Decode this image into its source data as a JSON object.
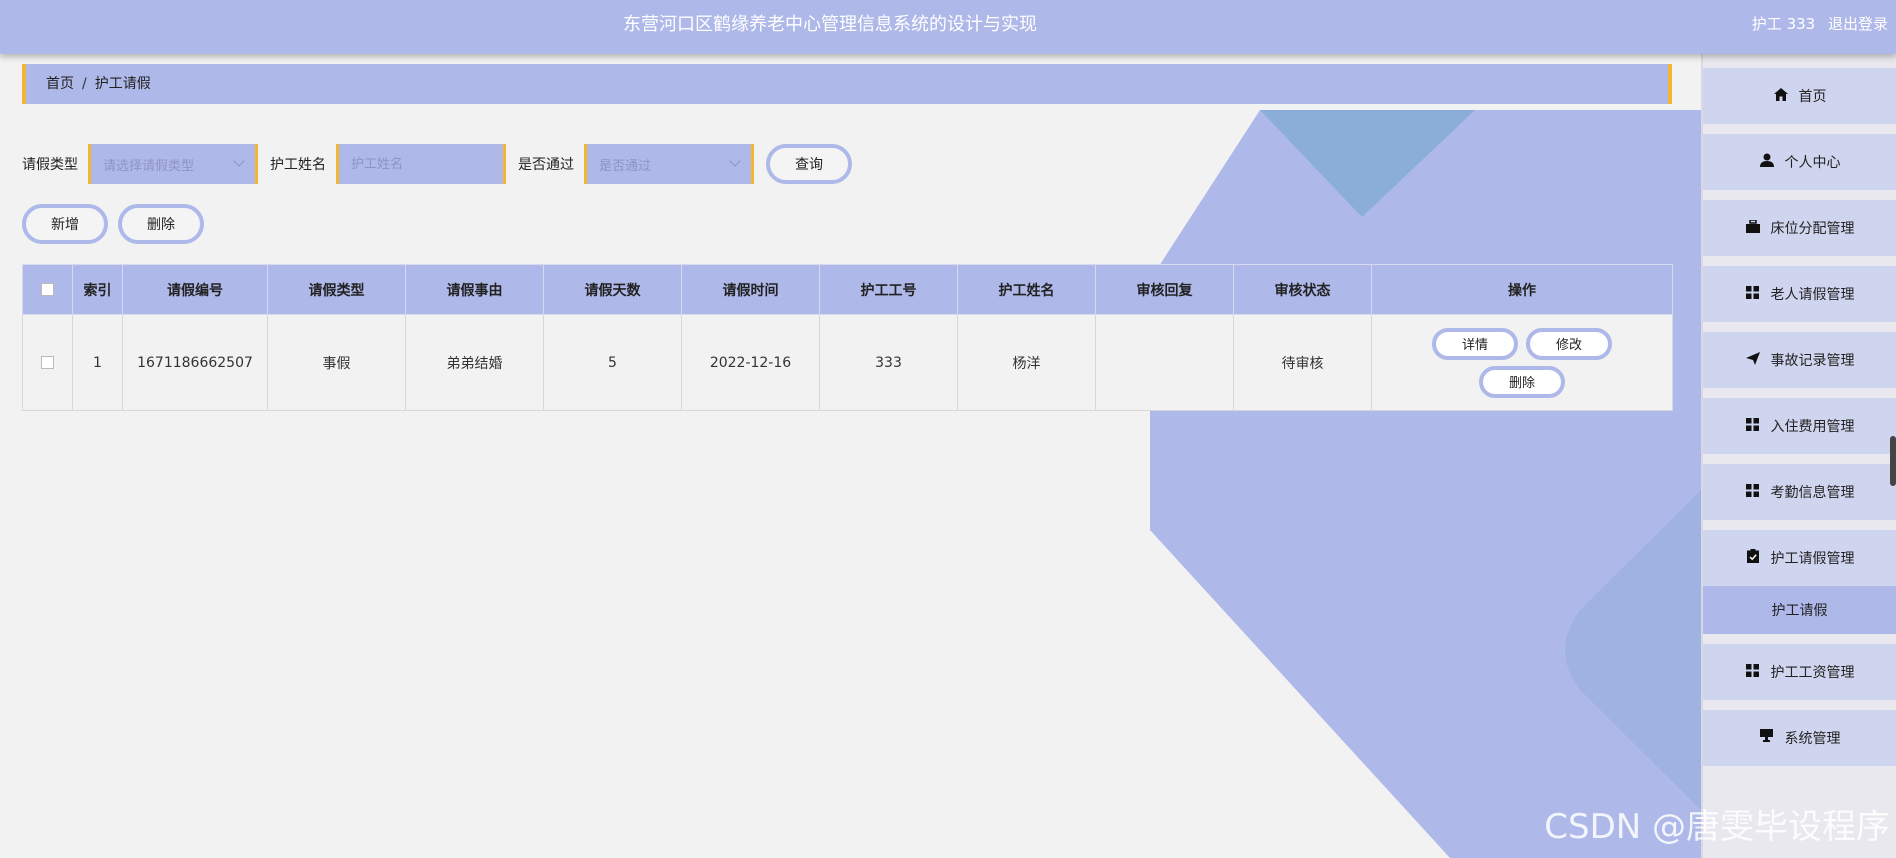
{
  "header": {
    "title": "东营河口区鹤缘养老中心管理信息系统的设计与实现",
    "user_label": "护工 333",
    "logout_label": "退出登录"
  },
  "breadcrumb": {
    "home": "首页",
    "separator": "/",
    "current": "护工请假"
  },
  "search": {
    "leave_type_label": "请假类型",
    "leave_type_placeholder": "请选择请假类型",
    "nurse_name_label": "护工姓名",
    "nurse_name_placeholder": "护工姓名",
    "approved_label": "是否通过",
    "approved_placeholder": "是否通过",
    "query_button": "查询"
  },
  "actions": {
    "add_button": "新增",
    "delete_button": "删除"
  },
  "table": {
    "columns": [
      "索引",
      "请假编号",
      "请假类型",
      "请假事由",
      "请假天数",
      "请假时间",
      "护工工号",
      "护工姓名",
      "审核回复",
      "审核状态",
      "操作"
    ],
    "rows": [
      {
        "index": "1",
        "leave_no": "1671186662507",
        "leave_type": "事假",
        "reason": "弟弟结婚",
        "days": "5",
        "date": "2022-12-16",
        "nurse_no": "333",
        "nurse_name": "杨洋",
        "review_reply": "",
        "review_status": "待审核",
        "ops": {
          "detail": "详情",
          "edit": "修改",
          "delete": "删除"
        }
      }
    ]
  },
  "sidebar": {
    "items": [
      {
        "label": "首页",
        "icon": "home-icon"
      },
      {
        "label": "个人中心",
        "icon": "user-icon"
      },
      {
        "label": "床位分配管理",
        "icon": "briefcase-icon"
      },
      {
        "label": "老人请假管理",
        "icon": "grid-icon"
      },
      {
        "label": "事故记录管理",
        "icon": "send-icon"
      },
      {
        "label": "入住费用管理",
        "icon": "grid-icon"
      },
      {
        "label": "考勤信息管理",
        "icon": "grid-icon"
      },
      {
        "label": "护工请假管理",
        "icon": "clipboard-check-icon"
      },
      {
        "label": "护工工资管理",
        "icon": "grid-icon"
      },
      {
        "label": "系统管理",
        "icon": "desktop-icon"
      }
    ],
    "active_sub_item": "护工请假"
  },
  "watermark": "CSDN @唐雯毕设程序",
  "colors": {
    "accent": "#aeb8e9",
    "border_accent": "#f2b634",
    "background": "#f2f2f2"
  }
}
